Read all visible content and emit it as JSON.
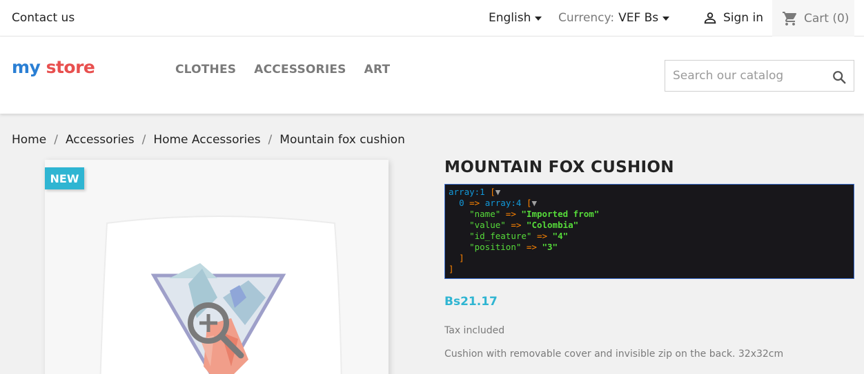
{
  "topbar": {
    "contact": "Contact us",
    "language": "English",
    "currency_label": "Currency:",
    "currency_value": "VEF Bs",
    "signin": "Sign in",
    "cart": "Cart (0)"
  },
  "header": {
    "logo_part1": "my",
    "logo_part2": "store",
    "nav": [
      "CLOTHES",
      "ACCESSORIES",
      "ART"
    ],
    "search_placeholder": "Search our catalog"
  },
  "breadcrumb": [
    "Home",
    "Accessories",
    "Home Accessories",
    "Mountain fox cushion"
  ],
  "product": {
    "badge": "NEW",
    "title": "MOUNTAIN FOX CUSHION",
    "price": "Bs21.17",
    "tax": "Tax included",
    "description": "Cushion with removable cover and invisible zip on the back. 32x32cm"
  },
  "debug_dump": {
    "line1_type": "array:1",
    "line2_index": "0",
    "line2_type": "array:4",
    "fields": [
      {
        "key": "\"name\"",
        "value": "\"Imported from\""
      },
      {
        "key": "\"value\"",
        "value": "\"Colombia\""
      },
      {
        "key": "\"id_feature\"",
        "value": "\"4\""
      },
      {
        "key": "\"position\"",
        "value": "\"3\""
      }
    ]
  },
  "colors": {
    "accent": "#2fb5d2",
    "dump_bg": "#18171b",
    "dump_type": "#1299da",
    "dump_operator": "#ff8400",
    "dump_string": "#56db3a"
  },
  "icons": [
    "caret-down-icon",
    "user-icon",
    "cart-icon",
    "search-icon",
    "zoom-in-icon"
  ]
}
